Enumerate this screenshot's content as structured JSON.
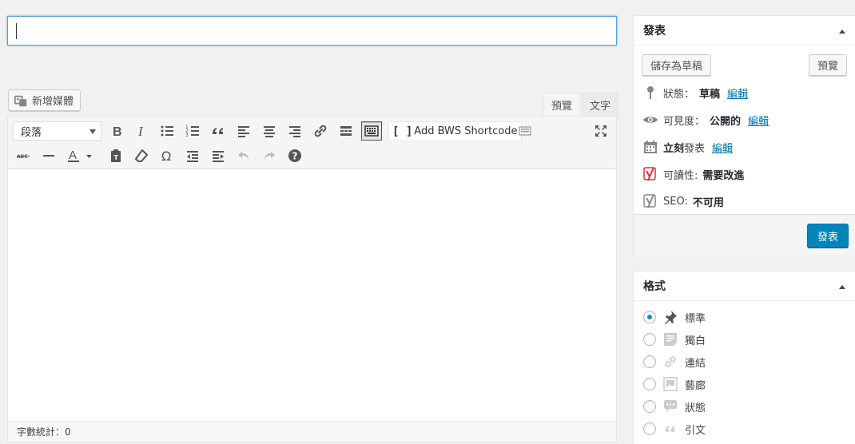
{
  "editor": {
    "title_value": "",
    "add_media_label": "新增媒體",
    "tabs": [
      {
        "label": "預覽"
      },
      {
        "label": "文字"
      }
    ],
    "format_select_value": "段落",
    "shortcode_button_label": "Add BWS Shortcode",
    "word_count_label": "字數統計：0"
  },
  "publish": {
    "title": "發表",
    "save_draft_label": "儲存為草稿",
    "preview_label": "預覽",
    "status_label": "狀態：",
    "status_value": "草稿",
    "visibility_label": "可見度：",
    "visibility_value": "公開的",
    "schedule_value": "立刻",
    "schedule_suffix": "發表",
    "edit_link": "編輯",
    "readability_label": "可讀性:",
    "readability_value": "需要改進",
    "seo_label": "SEO:",
    "seo_value": "不可用",
    "publish_label": "發表"
  },
  "format": {
    "title": "格式",
    "options": [
      {
        "label": "標準",
        "icon": "pin-icon",
        "checked": true
      },
      {
        "label": "獨白",
        "icon": "aside-icon",
        "checked": false
      },
      {
        "label": "連結",
        "icon": "link-icon",
        "checked": false
      },
      {
        "label": "藝廊",
        "icon": "gallery-icon",
        "checked": false
      },
      {
        "label": "狀態",
        "icon": "status-icon",
        "checked": false
      },
      {
        "label": "引文",
        "icon": "quote-icon",
        "checked": false
      }
    ]
  },
  "colors": {
    "accent": "#0085ba",
    "link": "#0073aa",
    "yoast_red": "#dc3232"
  }
}
